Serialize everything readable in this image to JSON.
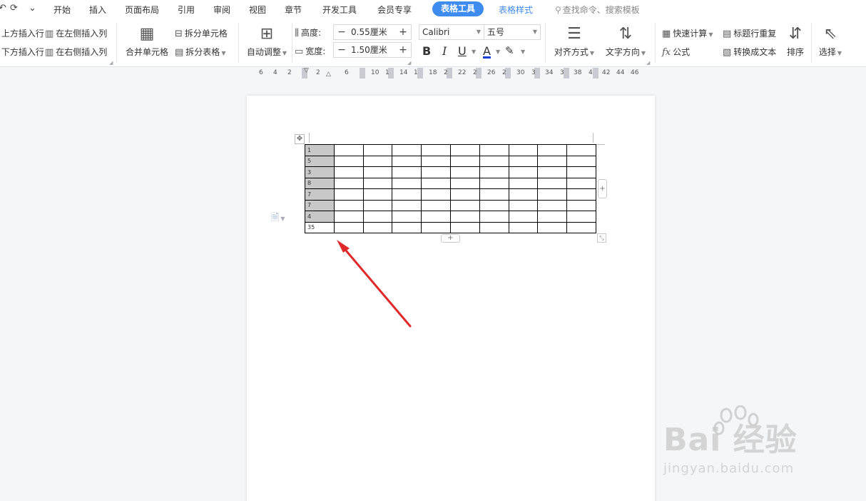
{
  "menubar": {
    "quick_redo": "⟳",
    "quick_more": "⌄",
    "tabs": [
      "开始",
      "插入",
      "页面布局",
      "引用",
      "审阅",
      "视图",
      "章节",
      "开发工具",
      "会员专享",
      "表格工具",
      "表格样式"
    ],
    "search_placeholder": "查找命令、搜索模板"
  },
  "ribbon": {
    "insert_above": "上方插入行",
    "insert_below": "下方插入行",
    "insert_left": "在左侧插入列",
    "insert_right": "在右侧插入列",
    "merge_cells": "合并单元格",
    "split_cells": "拆分单元格",
    "split_table": "拆分表格",
    "auto_fit": "自动调整",
    "height_label": "高度:",
    "height_value": "0.55厘米",
    "width_label": "宽度:",
    "width_value": "1.50厘米",
    "font_name": "Calibri",
    "font_size": "五号",
    "bold": "B",
    "italic": "I",
    "underline": "U",
    "font_color": "A",
    "align": "对齐方式",
    "text_direction": "文字方向",
    "quick_calc": "快速计算",
    "formula_icon": "fx",
    "formula": "公式",
    "repeat_header": "标题行重复",
    "to_text": "转换成文本",
    "sort": "排序",
    "select": "选择"
  },
  "ruler": {
    "ticks": [
      "6",
      "4",
      "2",
      "2",
      "6",
      "10",
      "1",
      "14",
      "1",
      "18",
      "2",
      "22",
      "2",
      "26",
      "2",
      "30",
      "3",
      "34",
      "3",
      "38",
      "4",
      "42",
      "44",
      "46"
    ]
  },
  "table": {
    "first_column": [
      "1",
      "5",
      "3",
      "8",
      "7",
      "7",
      "4",
      "35"
    ]
  },
  "watermark": {
    "brand": "Bai 经验",
    "url": "jingyan.baidu.com"
  },
  "colors": {
    "accent": "#3f8cf0",
    "arrow": "#e02a2a",
    "cell_shade": "#c8c8c8"
  }
}
